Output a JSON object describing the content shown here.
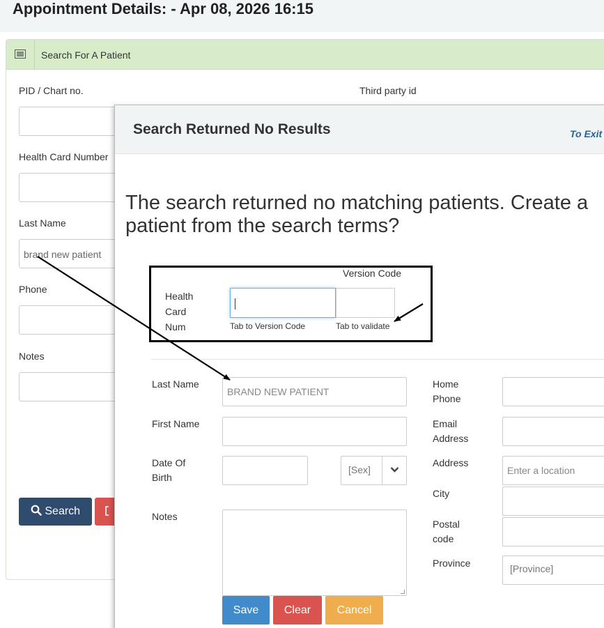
{
  "page": {
    "title": "Appointment Details: - Apr 08, 2026 16:15"
  },
  "panel": {
    "icon": "list-icon",
    "title": "Search For A Patient",
    "labels": {
      "pid": "PID / Chart no.",
      "third_party": "Third party id",
      "health_card": "Health Card Number",
      "last_name": "Last Name",
      "phone": "Phone",
      "notes": "Notes"
    },
    "last_name_value": "brand new patient",
    "search_label": "Search",
    "search_icon": "search-icon"
  },
  "modal": {
    "title": "Search Returned No Results",
    "exit": "To Exit",
    "message": "The search returned no matching patients. Create a\npatient from the search terms?",
    "health_card": {
      "label": "Health Card Num",
      "version_code_label": "Version Code",
      "hint_version": "Tab to Version Code",
      "hint_validate": "Tab to validate"
    },
    "form": {
      "last_name_label": "Last Name",
      "last_name_value": "BRAND NEW PATIENT",
      "first_name_label": "First Name",
      "dob_label": "Date Of Birth",
      "sex_placeholder": "[Sex]",
      "notes_label": "Notes",
      "home_phone_label": "Home Phone",
      "email_label": "Email Address",
      "address_label": "Address",
      "address_placeholder": "Enter a location",
      "city_label": "City",
      "postal_label": "Postal code",
      "province_label": "Province",
      "province_placeholder": "[Province]"
    },
    "buttons": {
      "save": "Save",
      "clear": "Clear",
      "cancel": "Cancel"
    }
  },
  "colors": {
    "panel_heading": "#d8ecca",
    "search_button": "#2f4b6e",
    "save_button": "#428bca",
    "clear_button": "#d9534f",
    "cancel_button": "#f0ad4e",
    "exit_link": "#2a6496"
  }
}
